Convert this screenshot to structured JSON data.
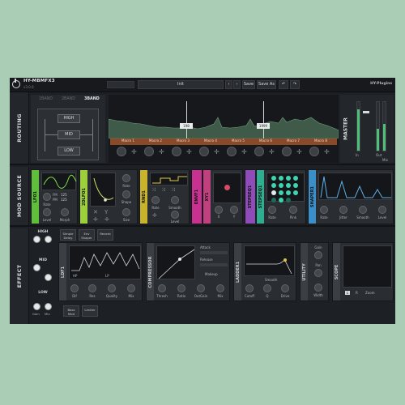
{
  "app": {
    "title": "HY-MBMFX3",
    "subtitle": "v3.0.0",
    "preset_name": "Init",
    "save_label": "Save",
    "save_as_label": "Save As",
    "brand": "HY-Plugins",
    "colors": {
      "background": "#a9cdb5",
      "panel": "#1d2024",
      "accent_green": "#4fbf7a",
      "macro_bar": "#8a4a2a"
    }
  },
  "routing": {
    "label": "ROUTING",
    "band_tabs": [
      "1BAND",
      "2BAND",
      "3BAND"
    ],
    "active_band_tab": "3BAND",
    "bands": [
      "HIGH",
      "MID",
      "LOW"
    ],
    "markers": [
      "198",
      "1999"
    ],
    "macros": [
      "Macro 1",
      "Macro 2",
      "Macro 3",
      "Macro 4",
      "Macro 5",
      "Macro 6",
      "Macro 7",
      "Macro 8"
    ]
  },
  "master": {
    "label": "MASTER",
    "in_label": "In",
    "out_label": "Out",
    "mix_label": "Mix",
    "meter_levels": [
      0.85,
      0.45,
      0.55
    ]
  },
  "mod_source": {
    "label": "MOD SOURCE",
    "modules": [
      {
        "name": "LFO1",
        "color": "#5fbf3a",
        "knobs": [
          "Rate",
          "Morph",
          "Level"
        ],
        "extras": [
          "FM",
          "PM"
        ],
        "values": [
          "125",
          "125"
        ]
      },
      {
        "name": "2DLFO1",
        "color": "#9ccf3a",
        "knobs": [
          "Rate",
          "Shape",
          "Size"
        ]
      },
      {
        "name": "RND1",
        "color": "#c9b32a",
        "knobs": [
          "Rate",
          "Smooth",
          "Level"
        ]
      },
      {
        "name": "ENVF1",
        "color": "#c8318f",
        "knobs": []
      },
      {
        "name": "XY1",
        "color": "#c0417d",
        "knobs": [
          "X",
          "Y"
        ]
      },
      {
        "name": "STEPSEQ1",
        "color": "#8f4bb8",
        "knobs": []
      },
      {
        "name": "STEPSEQ1",
        "color": "#2fae8f",
        "knobs": [
          "Rate",
          "Pink"
        ]
      },
      {
        "name": "SHAPER1",
        "color": "#3b8fc8",
        "knobs": [
          "Rate",
          "Jitter",
          "Smooth",
          "Level"
        ]
      }
    ]
  },
  "effect": {
    "label": "EFFECT",
    "bands": [
      "HIGH",
      "MID",
      "LOW"
    ],
    "gain_label": "Gain",
    "mix_label": "Mix",
    "chain_high": [
      "Simple Delay",
      "Env Shaper",
      "Reverb"
    ],
    "chain_low": [
      "Bass Mod",
      "Limiter"
    ],
    "modules": [
      {
        "name": "LDF1",
        "knobs": [
          "Dif",
          "Res",
          "Quality",
          "Mix"
        ],
        "modes": [
          "HP",
          "LP"
        ]
      },
      {
        "name": "COMPRESSOR",
        "knobs": [
          "Thresh",
          "Ratio",
          "OutGain",
          "Mix"
        ],
        "side": [
          "Attack",
          "Release",
          "Makeup"
        ]
      },
      {
        "name": "LADDER1",
        "knobs": [
          "Cutoff",
          "Q",
          "Drive"
        ],
        "extra": "Smooth"
      },
      {
        "name": "UTILITY",
        "knobs": [
          "Gain",
          "Pan",
          "Width"
        ]
      },
      {
        "name": "SCOPE",
        "footer": [
          "L",
          "R",
          "Zoom"
        ]
      }
    ]
  }
}
